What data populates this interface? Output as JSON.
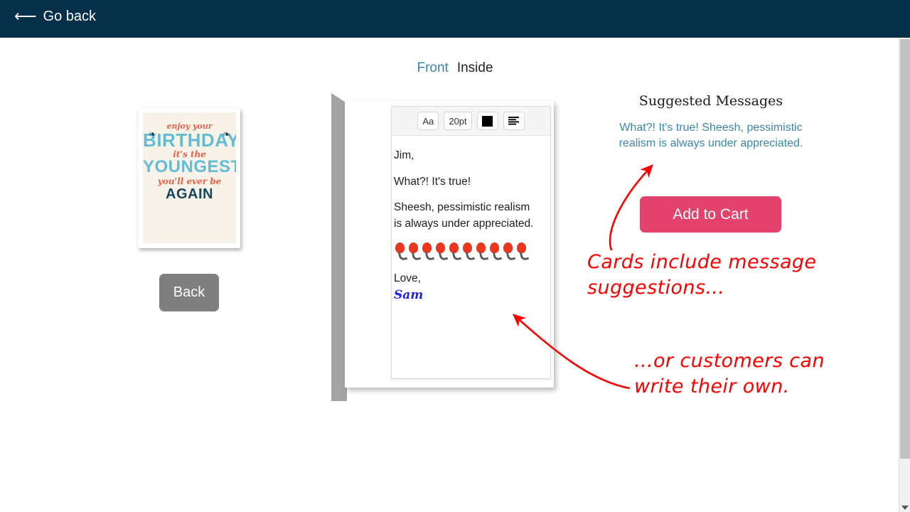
{
  "topbar": {
    "back_arrow": "⟵",
    "go_back_label": "Go back"
  },
  "tabs": [
    {
      "label": "Front",
      "active": false
    },
    {
      "label": "Inside",
      "active": true
    }
  ],
  "preview": {
    "card_art": {
      "line1": "enjoy your",
      "line2": "BIRTHDAY",
      "line3": "it's the",
      "line4": "YOUNGEST",
      "line5": "you'll ever be",
      "line6": "AGAIN",
      "swirl_left": "❧",
      "swirl_right": "❧",
      "background_color": "#f8f3e9",
      "accent_color": "#63bcd4",
      "script_color": "#e8614a"
    },
    "back_button_label": "Back"
  },
  "editor": {
    "toolbar": {
      "font_label": "Aa",
      "size_label": "20pt",
      "color_value": "#000000",
      "align_label": "align-left"
    },
    "message": {
      "greeting": "Jim,",
      "line_1": "What?! It's true!",
      "line_2a": "Sheesh, pessimistic realism",
      "line_2b": "is always under appreciated.",
      "balloon_count": 10,
      "closing": "Love,",
      "signature": "Sam"
    }
  },
  "suggested": {
    "title": "Suggested Messages",
    "message": "What?! It's true! Sheesh, pessimistic realism is always under appreciated.",
    "add_to_cart_label": "Add to Cart",
    "accent_color": "#3d87a8",
    "cart_button_color": "#e2426b"
  },
  "annotations": [
    {
      "text": "Cards include message\nsuggestions...",
      "color": "#ff0000"
    },
    {
      "text": "...or customers can\nwrite their own.",
      "color": "#ff0000"
    }
  ]
}
